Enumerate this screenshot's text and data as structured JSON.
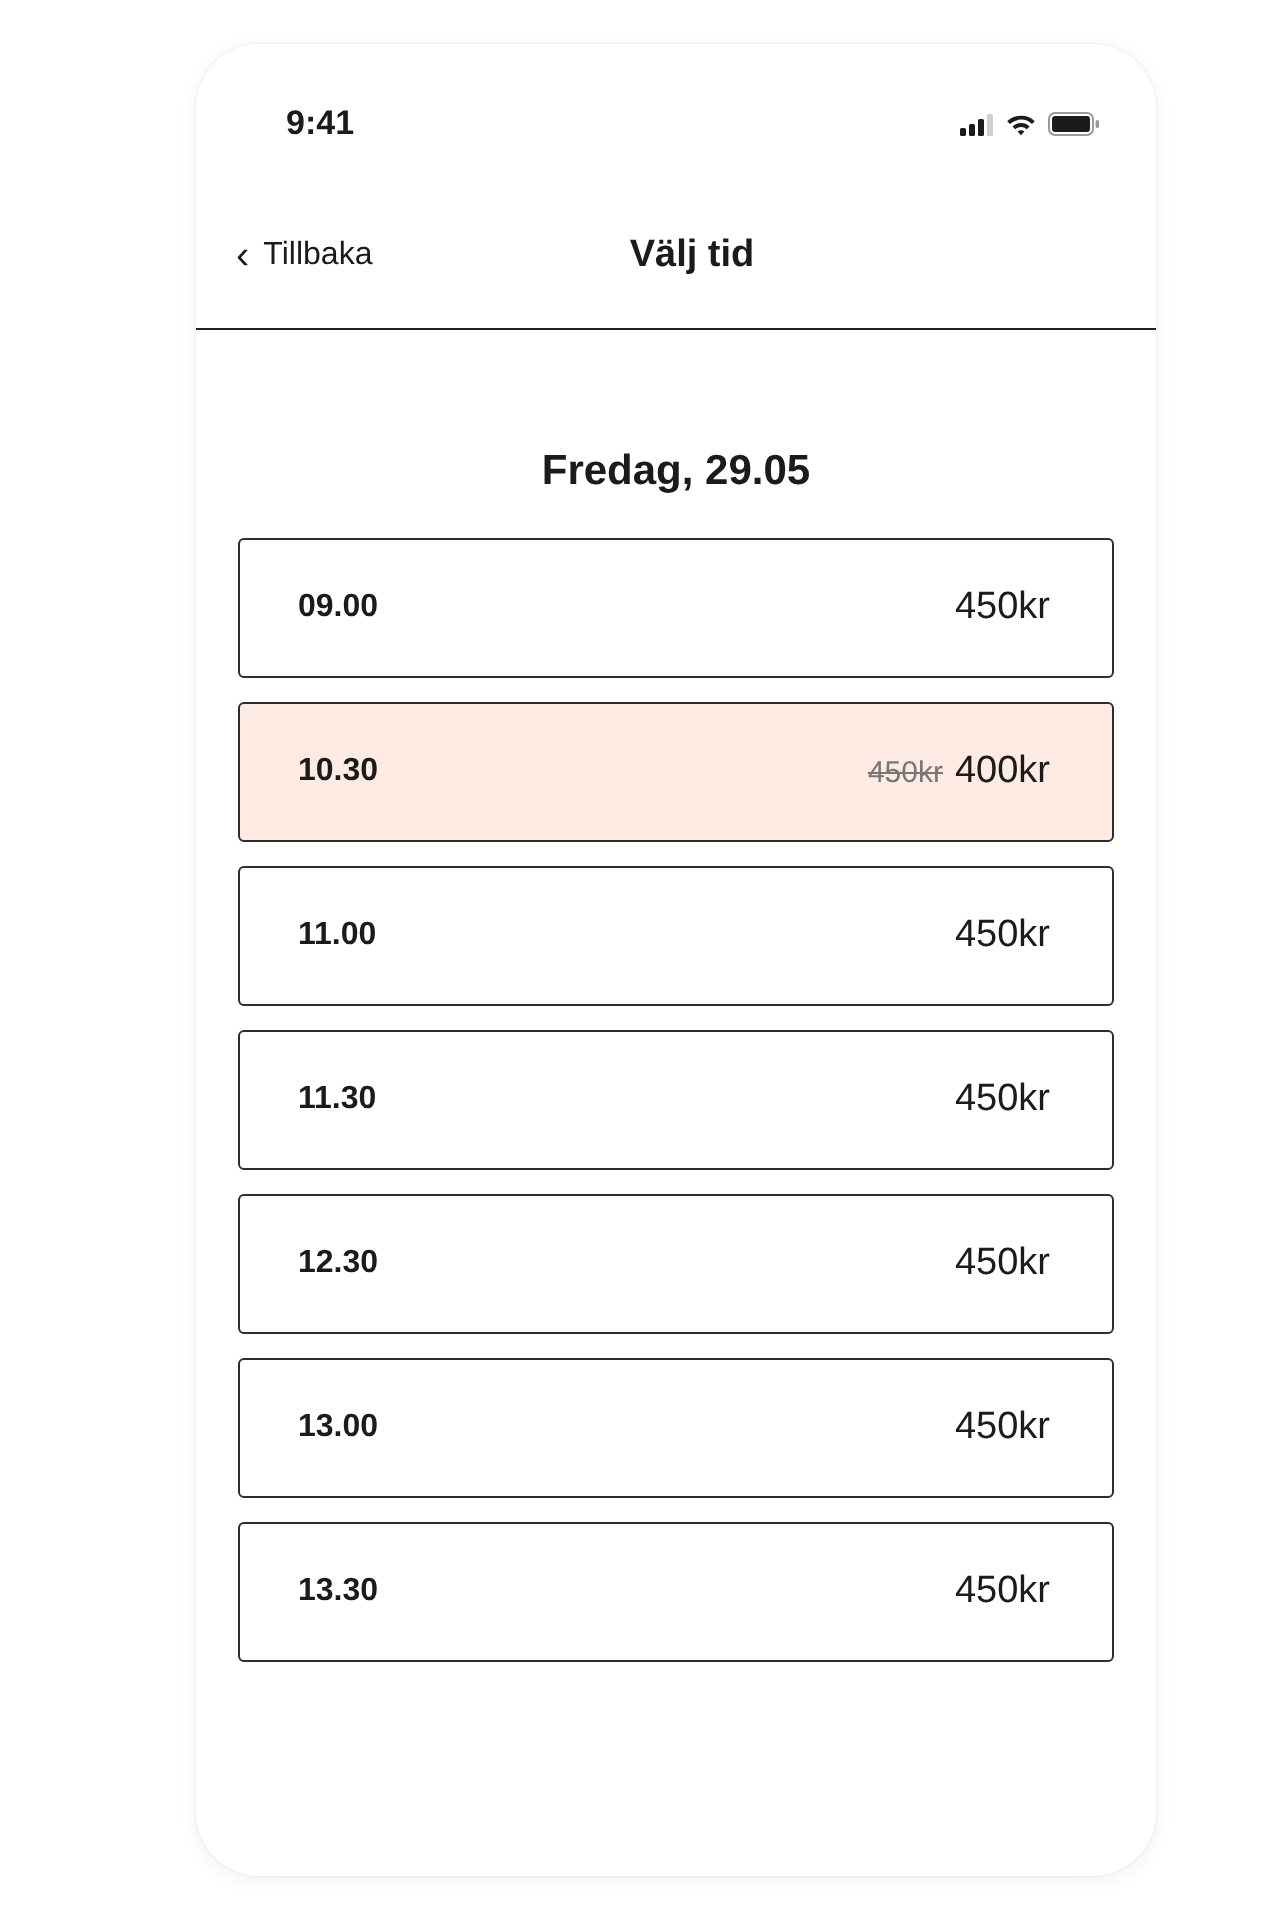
{
  "status_bar": {
    "time": "9:41"
  },
  "nav": {
    "back_label": "Tillbaka",
    "back_icon": "‹",
    "title": "Välj tid"
  },
  "date": "Fredag, 29.05",
  "slots": [
    {
      "time": "09.00",
      "price": "450kr",
      "selected": false
    },
    {
      "time": "10.30",
      "old_price": "450kr",
      "price": "400kr",
      "selected": true
    },
    {
      "time": "11.00",
      "price": "450kr",
      "selected": false
    },
    {
      "time": "11.30",
      "price": "450kr",
      "selected": false
    },
    {
      "time": "12.30",
      "price": "450kr",
      "selected": false
    },
    {
      "time": "13.00",
      "price": "450kr",
      "selected": false
    },
    {
      "time": "13.30",
      "price": "450kr",
      "selected": false
    }
  ]
}
